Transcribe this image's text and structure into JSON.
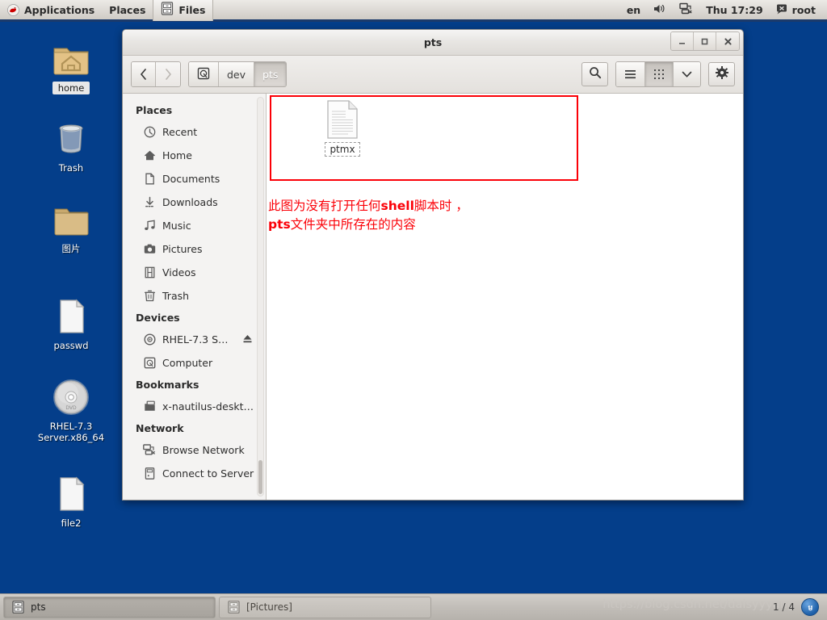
{
  "top_panel": {
    "logo_icon": "redhat-logo-icon",
    "applications_label": "Applications",
    "places_label": "Places",
    "active_app_label": "Files",
    "active_app_icon": "file-cabinet-icon",
    "keyboard_layout": "en",
    "volume_icon": "speaker-icon",
    "network_icon": "network-disconnected-icon",
    "clock": "Thu 17:29",
    "user_icon": "user-status-icon",
    "user_label": "root"
  },
  "desktop": {
    "background_color": "#043e8a",
    "icons": [
      {
        "label": "home",
        "icon": "home-folder-icon",
        "selected": true
      },
      {
        "label": "Trash",
        "icon": "trash-icon",
        "selected": false
      },
      {
        "label": "图片",
        "icon": "folder-icon",
        "selected": false
      },
      {
        "label": "passwd",
        "icon": "document-icon",
        "selected": false
      },
      {
        "label": "RHEL-7.3 Server.x86_64",
        "icon": "dvd-disc-icon",
        "selected": false
      },
      {
        "label": "file2",
        "icon": "document-icon",
        "selected": false
      }
    ]
  },
  "window": {
    "title": "pts",
    "buttons": {
      "minimize": "_",
      "maximize": "□",
      "close": "✕"
    },
    "toolbar": {
      "back_icon": "chevron-left-icon",
      "forward_icon": "chevron-right-icon",
      "back_enabled": "true",
      "forward_enabled": "false",
      "breadcrumb": [
        {
          "label": "",
          "icon": "computer-icon",
          "active": false
        },
        {
          "label": "dev",
          "icon": "",
          "active": false
        },
        {
          "label": "pts",
          "icon": "",
          "active": true
        }
      ],
      "search_icon": "search-icon",
      "list_view_icon": "list-view-icon",
      "grid_view_icon": "grid-view-icon",
      "grid_view_active": "true",
      "dropdown_icon": "chevron-down-icon",
      "settings_icon": "gear-icon"
    }
  },
  "sidebar": {
    "sections": [
      {
        "heading": "Places",
        "items": [
          {
            "label": "Recent",
            "icon": "clock-icon"
          },
          {
            "label": "Home",
            "icon": "home-icon"
          },
          {
            "label": "Documents",
            "icon": "document-icon"
          },
          {
            "label": "Downloads",
            "icon": "download-icon"
          },
          {
            "label": "Music",
            "icon": "music-note-icon"
          },
          {
            "label": "Pictures",
            "icon": "camera-icon"
          },
          {
            "label": "Videos",
            "icon": "film-icon"
          },
          {
            "label": "Trash",
            "icon": "trash-icon"
          }
        ]
      },
      {
        "heading": "Devices",
        "items": [
          {
            "label": "RHEL-7.3 S…",
            "icon": "disc-icon",
            "eject": "eject-icon"
          },
          {
            "label": "Computer",
            "icon": "computer-icon"
          }
        ]
      },
      {
        "heading": "Bookmarks",
        "items": [
          {
            "label": "x-nautilus-deskt…",
            "icon": "remote-folder-icon"
          }
        ]
      },
      {
        "heading": "Network",
        "items": [
          {
            "label": "Browse Network",
            "icon": "network-icon"
          },
          {
            "label": "Connect to Server",
            "icon": "server-icon"
          }
        ]
      }
    ]
  },
  "content": {
    "files": [
      {
        "name": "ptmx",
        "icon": "text-document-icon",
        "focused": true
      }
    ],
    "annotation": {
      "box_color": "#fb0007",
      "text_color": "#fb0007",
      "line1_pre": "此图为没有打开任何",
      "line1_bold": "shell",
      "line1_post": "脚本时 ，",
      "line2_bold": "pts",
      "line2_post": "文件夹中所存在的内容"
    }
  },
  "taskbar": {
    "tasks": [
      {
        "label": "pts",
        "icon": "file-cabinet-icon",
        "active": true
      },
      {
        "label": "[Pictures]",
        "icon": "file-cabinet-icon",
        "active": false
      }
    ],
    "watermark": "https://blog.csdn.net/daisyyyang",
    "workspace": "1 / 4",
    "tray_icon": "ibus-input-icon"
  }
}
